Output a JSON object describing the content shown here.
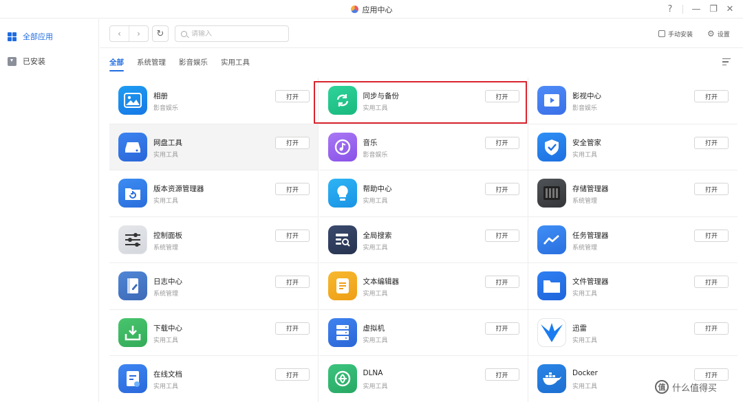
{
  "window": {
    "title": "应用中心",
    "controls": {
      "help": "?",
      "minimize": "—",
      "restore": "❐",
      "close": "✕"
    }
  },
  "sidebar": {
    "items": [
      {
        "label": "全部应用",
        "icon": "grid-icon",
        "active": true
      },
      {
        "label": "已安装",
        "icon": "download-icon",
        "active": false
      }
    ]
  },
  "toolbar": {
    "back": "‹",
    "forward": "›",
    "refresh": "↻",
    "search_placeholder": "请输入",
    "manual_install_label": "手动安装",
    "settings_label": "设置"
  },
  "tabs": [
    {
      "label": "全部",
      "active": true
    },
    {
      "label": "系统管理",
      "active": false
    },
    {
      "label": "影音娱乐",
      "active": false
    },
    {
      "label": "实用工具",
      "active": false
    }
  ],
  "open_label": "打开",
  "apps": [
    {
      "name": "相册",
      "category": "影音娱乐",
      "icon": "photo-icon",
      "color": "#1e9df2",
      "color2": "#1678e6"
    },
    {
      "name": "同步与备份",
      "category": "实用工具",
      "icon": "sync-icon",
      "color": "#2fd39a",
      "color2": "#19b97f"
    },
    {
      "name": "影视中心",
      "category": "影音娱乐",
      "icon": "video-icon",
      "color": "#4f8cf7",
      "color2": "#3a6fe8"
    },
    {
      "name": "网盘工具",
      "category": "实用工具",
      "icon": "cloud-drive-icon",
      "color": "#3b83f0",
      "color2": "#2a66d8"
    },
    {
      "name": "音乐",
      "category": "影音娱乐",
      "icon": "music-icon",
      "color": "#a877f4",
      "color2": "#8a52e8"
    },
    {
      "name": "安全管家",
      "category": "实用工具",
      "icon": "shield-icon",
      "color": "#2e8ff5",
      "color2": "#1d6fe0"
    },
    {
      "name": "版本资源管理器",
      "category": "实用工具",
      "icon": "folder-restore-icon",
      "color": "#3c8cf3",
      "color2": "#2a6ddb"
    },
    {
      "name": "帮助中心",
      "category": "实用工具",
      "icon": "lightbulb-icon",
      "color": "#2eb4f5",
      "color2": "#1a93e4"
    },
    {
      "name": "存储管理器",
      "category": "系统管理",
      "icon": "storage-icon",
      "color": "#505357",
      "color2": "#333538"
    },
    {
      "name": "控制面板",
      "category": "系统管理",
      "icon": "sliders-icon",
      "color": "#e4e6ea",
      "color2": "#d4d7dc"
    },
    {
      "name": "全局搜索",
      "category": "实用工具",
      "icon": "search-panel-icon",
      "color": "#3a4a6e",
      "color2": "#27334f"
    },
    {
      "name": "任务管理器",
      "category": "系统管理",
      "icon": "chart-icon",
      "color": "#3f8ef5",
      "color2": "#2a6fe0"
    },
    {
      "name": "日志中心",
      "category": "系统管理",
      "icon": "log-icon",
      "color": "#4f86d6",
      "color2": "#3d6ab7"
    },
    {
      "name": "文本编辑器",
      "category": "实用工具",
      "icon": "text-edit-icon",
      "color": "#f7b82f",
      "color2": "#ee9f16"
    },
    {
      "name": "文件管理器",
      "category": "实用工具",
      "icon": "folder-icon",
      "color": "#2f7ff2",
      "color2": "#1e64db"
    },
    {
      "name": "下载中心",
      "category": "实用工具",
      "icon": "download-box-icon",
      "color": "#49c56e",
      "color2": "#33ab58"
    },
    {
      "name": "虚拟机",
      "category": "实用工具",
      "icon": "server-icon",
      "color": "#3f83f0",
      "color2": "#2b66d6"
    },
    {
      "name": "迅雷",
      "category": "实用工具",
      "icon": "thunder-bird-icon",
      "color": "#ffffff",
      "color2": "#ffffff"
    },
    {
      "name": "在线文档",
      "category": "实用工具",
      "icon": "doc-icon",
      "color": "#3d86f2",
      "color2": "#2a68db"
    },
    {
      "name": "DLNA",
      "category": "实用工具",
      "icon": "dlna-icon",
      "color": "#3cc47e",
      "color2": "#27a863"
    },
    {
      "name": "Docker",
      "category": "实用工具",
      "icon": "docker-whale-icon",
      "color": "#2a85e6",
      "color2": "#1c6fd1"
    }
  ],
  "watermark": {
    "text": "什么值得买",
    "logo": "值"
  }
}
